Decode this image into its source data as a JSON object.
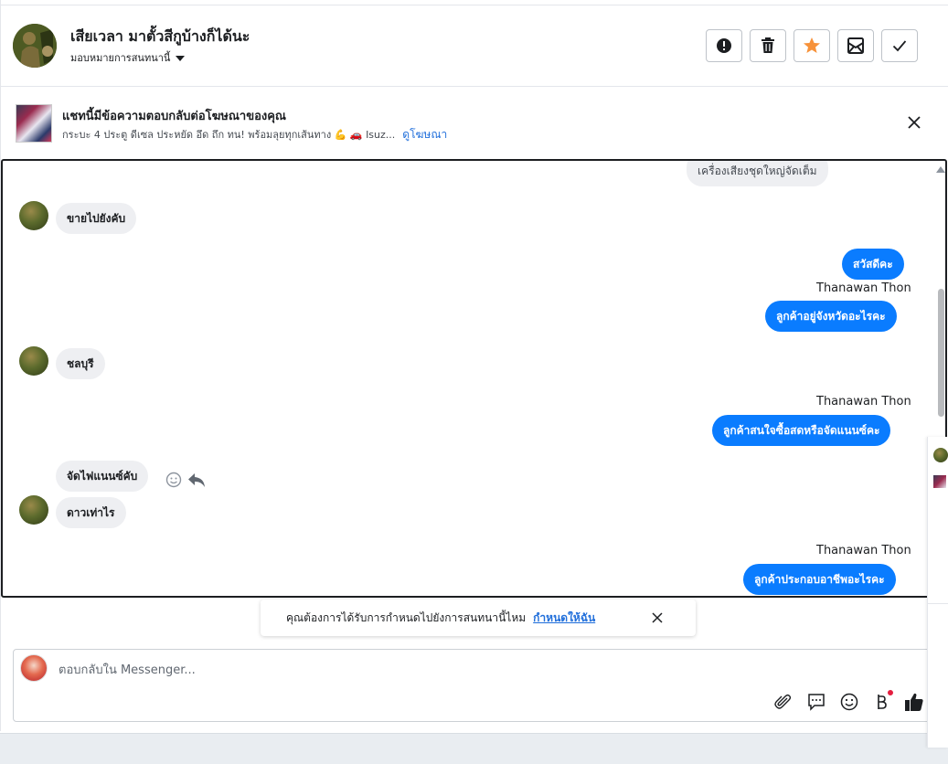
{
  "header": {
    "contact_name": "เสียเวลา มาตั้วสีกูบ้างก็ได้นะ",
    "assign_label": "มอบหมายการสนทนานี้",
    "actions": [
      "spam",
      "delete",
      "star",
      "mark-unread",
      "done"
    ],
    "star_color": "#f7923a"
  },
  "ad_banner": {
    "title": "แชทนี้มีข้อความตอบกลับต่อโฆษณาของคุณ",
    "subtitle": "กระบะ 4 ประตู ดีเซล ประหยัด อึด ถึก ทน! พร้อมลุยทุกเส้นทาง 💪 🚗 Isuz...",
    "link": "ดูโฆษณา"
  },
  "messages": {
    "partial_top": "เครื่องเสียงชุดใหญ่จัดเต็ม",
    "m1": "ขายไปยังคับ",
    "m2": "สวัสดีคะ",
    "agent_name_1": "Thanawan Thon",
    "m3": "ลูกค้าอยู่จังหวัดอะไรคะ",
    "m4": "ชลบุรี",
    "agent_name_2": "Thanawan Thon",
    "m5": "ลูกค้าสนใจซื้อสดหรือจัดแนนซ์คะ",
    "m6": "จัดไฟแนนซ์คับ",
    "m7": "ดาวเท่าไร",
    "agent_name_3": "Thanawan Thon",
    "m8": "ลูกค้าประกอบอาชีพอะไรคะ"
  },
  "suggestion": {
    "text": "คุณต้องการได้รับการกำหนดไปยังการสนทนานี้ไหม",
    "link": "กำหนดให้ฉัน"
  },
  "composer": {
    "placeholder": "ตอบกลับใน Messenger..."
  },
  "colors": {
    "accent": "#0a7cff",
    "link": "#216fdb"
  }
}
